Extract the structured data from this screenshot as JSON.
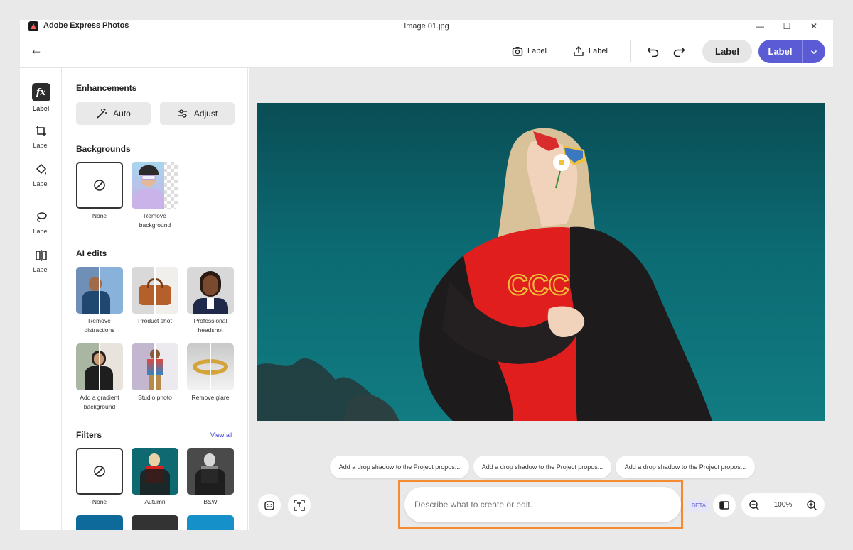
{
  "titlebar": {
    "app_name": "Adobe Express Photos",
    "doc_title": "Image 01.jpg"
  },
  "header": {
    "snapshot_label": "Label",
    "share_label": "Label",
    "secondary_label": "Label",
    "primary_label": "Label"
  },
  "rail": {
    "items": [
      {
        "label": "Label",
        "icon": "fx-icon"
      },
      {
        "label": "Label",
        "icon": "crop-icon"
      },
      {
        "label": "Label",
        "icon": "paint-bucket-icon"
      },
      {
        "label": "Label",
        "icon": "lasso-icon"
      },
      {
        "label": "Label",
        "icon": "compare-icon"
      }
    ]
  },
  "panel": {
    "enhancements": {
      "title": "Enhancements",
      "auto": "Auto",
      "adjust": "Adjust"
    },
    "backgrounds": {
      "title": "Backgrounds",
      "items": [
        "None",
        "Remove background"
      ]
    },
    "ai_edits": {
      "title": "AI edits",
      "items": [
        "Remove distractions",
        "Product shot",
        "Professional headshot",
        "Add a gradient background",
        "Studio photo",
        "Remove glare"
      ]
    },
    "filters": {
      "title": "Filters",
      "view_all": "View all",
      "items": [
        "None",
        "Autumn",
        "B&W"
      ]
    }
  },
  "suggestions": [
    "Add a drop shadow to the Project propos...",
    "Add a drop shadow to the Project propos...",
    "Add a drop shadow to the Project propos..."
  ],
  "prompt": {
    "placeholder": "Describe what to create or edit."
  },
  "badge": {
    "beta": "BETA"
  },
  "zoom": {
    "value": "100%"
  },
  "colors": {
    "accent": "#5b5bd6",
    "highlight_frame": "#f58a32"
  }
}
